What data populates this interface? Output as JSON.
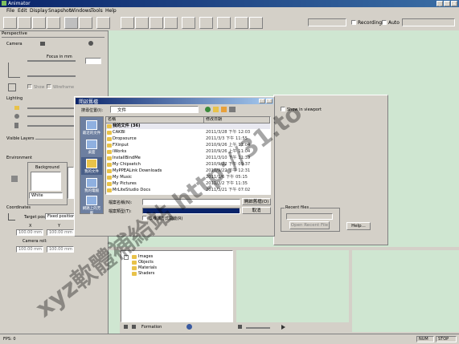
{
  "window": {
    "title": "Animator"
  },
  "menu": [
    "File",
    "Edit",
    "Display",
    "Snapshot",
    "Windows",
    "Tools",
    "Help"
  ],
  "toolbar_right": {
    "recording_label": "Recording",
    "auto_label": "Auto"
  },
  "sidebar": {
    "perspective": "Perspective",
    "camera": "Camera",
    "focus": "Focus in mm",
    "show": "Show",
    "wireframe": "Wireframe",
    "lighting": "Lighting",
    "visible_layers": "Visible Layers",
    "environment": "Environment",
    "background": "Background",
    "bg_color": "White",
    "coordinates": "Coordinates",
    "target_label": "Target pos:",
    "target_value": "Fixed position",
    "x_label": "X",
    "y_label": "Y",
    "x_value": "100.00 mm",
    "y_value": "100.00 mm",
    "camera_roll": "Camera roll:",
    "roll_x": "100.00 mm",
    "roll_y": "100.00 mm"
  },
  "dialog": {
    "title": "開啟舊檔",
    "lookin_label": "搜尋位置(I):",
    "lookin_value": "文件",
    "col_name": "名稱",
    "col_date": "修改日期",
    "places": [
      "最近的文件",
      "桌面",
      "我的文件",
      "我的電腦",
      "網路上的芳鄰"
    ],
    "files": [
      {
        "name": "我的文件 (36)",
        "date": ""
      },
      {
        "name": "CAKBI",
        "date": "2011/3/28 下午 12:03"
      },
      {
        "name": "Dropsource",
        "date": "2011/3/3 下午 11:55"
      },
      {
        "name": "FXinput",
        "date": "2010/9/26 上午 11:04"
      },
      {
        "name": "iWorks",
        "date": "2010/9/26 上午 11:04"
      },
      {
        "name": "InstallBindMe",
        "date": "2011/3/10 下午 11:39"
      },
      {
        "name": "My Chipsetch",
        "date": "2010/9/22 下午 09:37"
      },
      {
        "name": "MyPPEALink Downloads",
        "date": "2010/9/22 下午 12:31"
      },
      {
        "name": "My Music",
        "date": "2011/1/6 下午 05:15"
      },
      {
        "name": "My Pictures",
        "date": "2011/3/2 下午 11:35"
      },
      {
        "name": "MrLiteStudio Docs",
        "date": "2011/3/21 下午 07:02"
      }
    ],
    "filename_label": "檔案名稱(N):",
    "filetype_label": "檔案類型(T):",
    "open_button": "開啟舊檔(O)",
    "cancel_button": "取消",
    "readonly_label": "以唯讀方式開啟(R)"
  },
  "right_panel": {
    "show_item": "Show in viewport",
    "group_label": "Recent files",
    "open_button": "Open Recent File",
    "help_button": "Help..."
  },
  "bottom": {
    "tree": [
      "Images",
      "Objects",
      "Materials",
      "Shaders"
    ],
    "sub_label": "Formation"
  },
  "statusbar": {
    "left": "FPS: 0",
    "right_1": "NUM",
    "right_2": "STOP"
  },
  "watermark": "xyz軟體補給站 http://31.to"
}
